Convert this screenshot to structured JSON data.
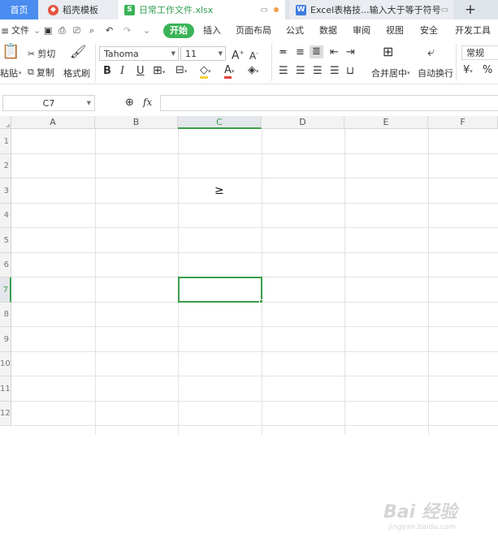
{
  "tabs": {
    "home": "首页",
    "template": "稻壳模板",
    "sheet": "日常工作文件.xlsx",
    "doc": "Excel表格技...输入大于等于符号",
    "add": "+"
  },
  "menu": {
    "file": "文件",
    "start": "开始",
    "insert": "插入",
    "layout": "页面布局",
    "formula": "公式",
    "data": "数据",
    "review": "审阅",
    "view": "视图",
    "security": "安全",
    "devtools": "开发工具"
  },
  "ribbon": {
    "paste": "粘贴",
    "cut": "剪切",
    "copy": "复制",
    "format_painter": "格式刷",
    "font_name": "Tahoma",
    "font_size": "11",
    "bold": "B",
    "italic": "I",
    "underline": "U",
    "merge_center": "合并居中",
    "wrap_text": "自动换行",
    "number_format": "常规"
  },
  "formula_bar": {
    "name_box": "C7",
    "fx": "fx",
    "content": ""
  },
  "grid": {
    "columns": [
      "A",
      "B",
      "C",
      "D",
      "E",
      "F"
    ],
    "rows": [
      "1",
      "2",
      "3",
      "4",
      "5",
      "6",
      "7",
      "8",
      "9",
      "10",
      "11",
      "12"
    ],
    "active_cell": "C7",
    "cell_c3": "≥"
  },
  "watermark": {
    "brand": "Bai 经验",
    "url": "jingyan.baidu.com"
  },
  "colors": {
    "accent_green": "#3ab357",
    "home_tab_blue": "#4a8cf0",
    "template_red": "#e5533d"
  }
}
